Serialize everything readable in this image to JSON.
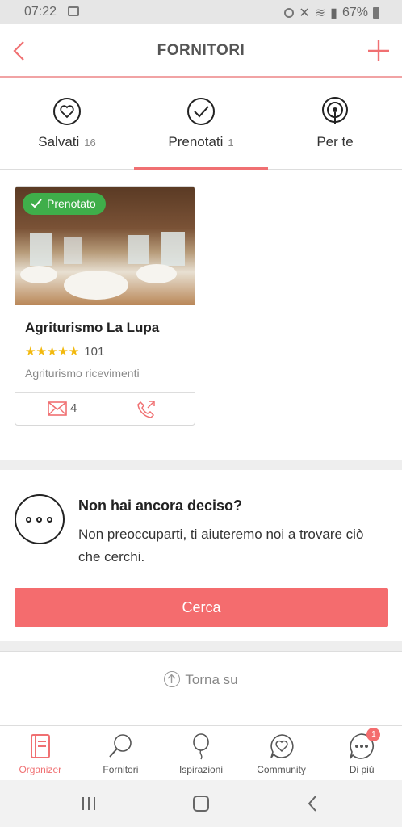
{
  "status_bar": {
    "time": "07:22",
    "battery": "67%"
  },
  "header": {
    "title": "FORNITORI"
  },
  "tabs": [
    {
      "label": "Salvati",
      "count": "16",
      "icon": "heart-icon"
    },
    {
      "label": "Prenotati",
      "count": "1",
      "icon": "check-icon",
      "active": true
    },
    {
      "label": "Per te",
      "count": "",
      "icon": "broadcast-icon"
    }
  ],
  "vendor_card": {
    "badge": "Prenotato",
    "name": "Agriturismo La Lupa",
    "rating": 5,
    "reviews": "101",
    "category": "Agriturismo ricevimenti",
    "messages": "4"
  },
  "help": {
    "title": "Non hai ancora deciso?",
    "text": "Non preoccuparti, ti aiuteremo noi a trovare ciò che cerchi.",
    "button": "Cerca"
  },
  "back_to_top": "Torna su",
  "bottom_nav": [
    {
      "label": "Organizer",
      "icon": "organizer-icon",
      "active": true
    },
    {
      "label": "Fornitori",
      "icon": "search-icon"
    },
    {
      "label": "Ispirazioni",
      "icon": "balloon-icon"
    },
    {
      "label": "Community",
      "icon": "community-icon"
    },
    {
      "label": "Di più",
      "icon": "more-icon",
      "badge": "1"
    }
  ],
  "colors": {
    "accent": "#f07072",
    "button": "#f46c6e",
    "badge_green": "#3fae4a",
    "star": "#f2b90f"
  }
}
